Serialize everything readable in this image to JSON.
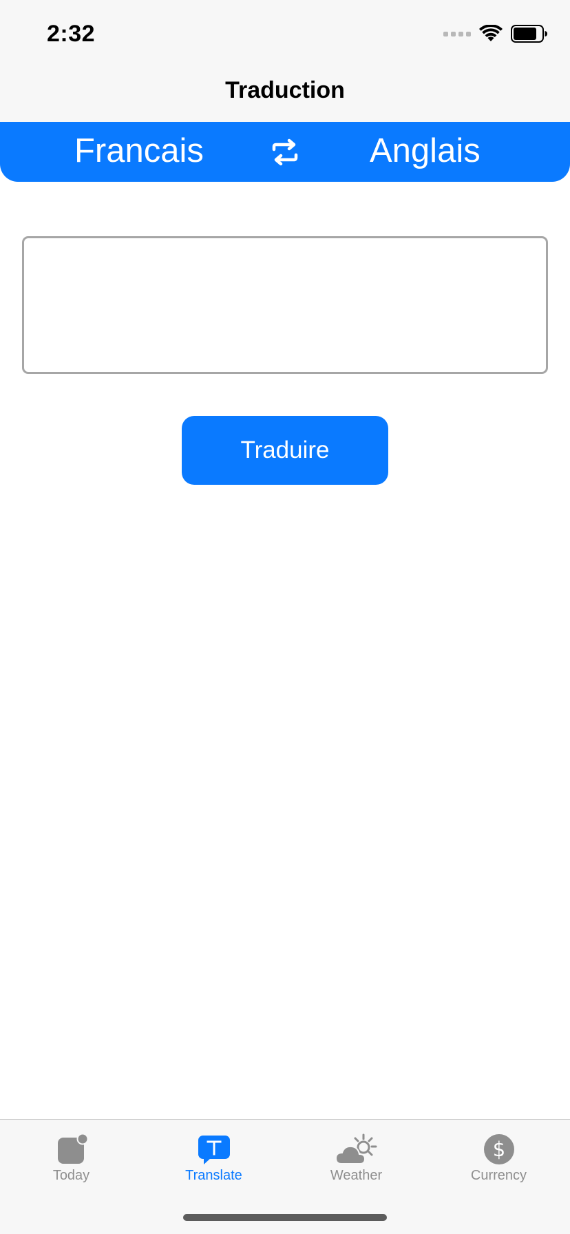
{
  "status_bar": {
    "time": "2:32"
  },
  "nav": {
    "title": "Traduction"
  },
  "language_bar": {
    "source": "Francais",
    "target": "Anglais",
    "swap_icon": "swap-arrows-icon"
  },
  "input": {
    "value": "",
    "placeholder": ""
  },
  "translate_button": {
    "label": "Traduire"
  },
  "tabs": [
    {
      "label": "Today",
      "icon": "today-badge-icon",
      "active": false
    },
    {
      "label": "Translate",
      "icon": "translate-bubble-icon",
      "active": true
    },
    {
      "label": "Weather",
      "icon": "partly-cloudy-icon",
      "active": false
    },
    {
      "label": "Currency",
      "icon": "dollar-circle-icon",
      "active": false
    }
  ],
  "colors": {
    "accent": "#0a7aff",
    "tab_inactive": "#8e8e8e",
    "bar_background": "#f7f7f7"
  }
}
